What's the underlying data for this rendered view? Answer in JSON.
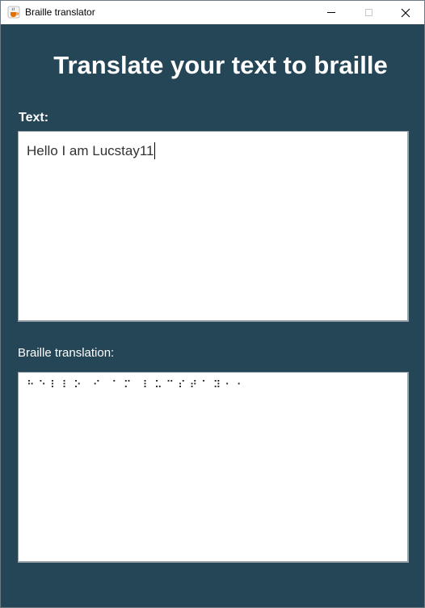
{
  "window": {
    "title": "Braille translator",
    "icon": "java-cup-icon"
  },
  "heading": "Translate your text to braille",
  "text_section": {
    "label": "Text:",
    "value": "Hello I am Lucstay11"
  },
  "braille_section": {
    "label": "Braille translation:",
    "value": "⠓⠑⠇⠇⠕ ⠊ ⠁⠍ ⠇⠥⠉⠎⠞⠁⠽⠂⠂"
  },
  "colors": {
    "background": "#254656",
    "text": "#ffffff"
  }
}
